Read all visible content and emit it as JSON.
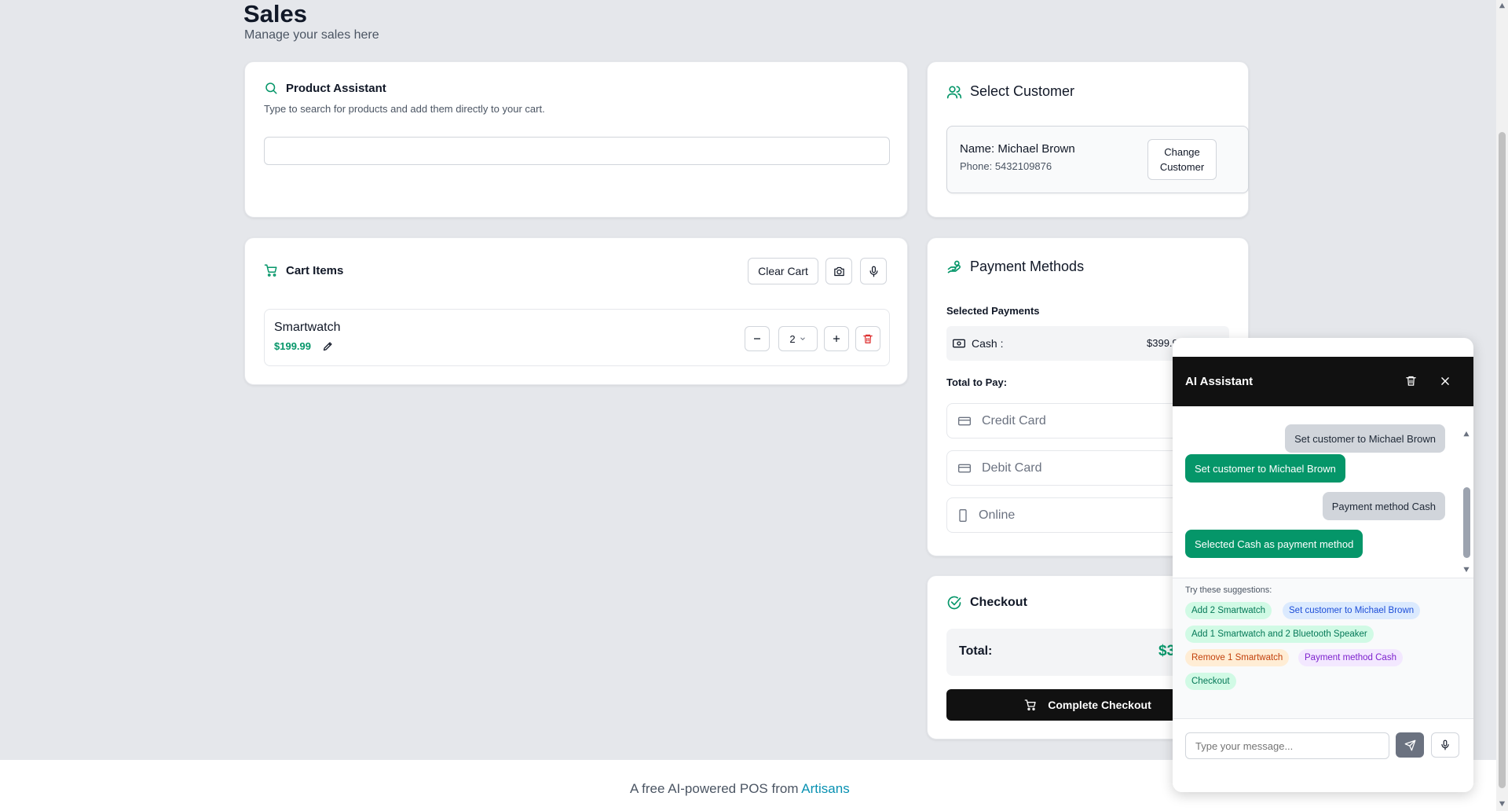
{
  "page": {
    "title": "Sales",
    "subtitle": "Manage your sales here"
  },
  "product_assistant": {
    "title": "Product Assistant",
    "description": "Type to search for products and add them directly to your cart.",
    "search_placeholder": "",
    "search_icon": "search-icon"
  },
  "cart": {
    "title": "Cart Items",
    "clear_label": "Clear Cart",
    "items": [
      {
        "name": "Smartwatch",
        "price": "$199.99",
        "quantity": "2"
      }
    ]
  },
  "customer": {
    "title": "Select Customer",
    "name": "Name: Michael Brown",
    "phone": "Phone: 5432109876",
    "change_label_1": "Change",
    "change_label_2": "Customer"
  },
  "payment": {
    "title": "Payment Methods",
    "selected_label": "Selected Payments",
    "selected": {
      "method": "Cash :",
      "amount": "$399.9"
    },
    "total_label": "Total to Pay:",
    "methods": [
      "Credit Card",
      "Debit Card",
      "Online"
    ]
  },
  "checkout": {
    "title": "Checkout",
    "total_label": "Total:",
    "total_value": "$3",
    "button_label": "Complete Checkout"
  },
  "footer": {
    "text": "A free AI-powered POS from ",
    "link": "Artisans"
  },
  "ai_assistant": {
    "title": "AI Assistant",
    "messages": [
      {
        "role": "user",
        "text": "Set customer to Michael Brown"
      },
      {
        "role": "bot",
        "text": "Set customer to Michael Brown"
      },
      {
        "role": "user",
        "text": "Payment method Cash"
      },
      {
        "role": "bot",
        "text": "Selected Cash as payment method"
      }
    ],
    "suggestions_label": "Try these suggestions:",
    "suggestions": [
      "Add 2 Smartwatch",
      "Set customer to Michael Brown",
      "Add 1 Smartwatch and 2 Bluetooth Speaker",
      "Remove 1 Smartwatch",
      "Payment method Cash",
      "Checkout"
    ],
    "input_placeholder": "Type your message..."
  },
  "colors": {
    "accent": "#059669",
    "dark": "#111111",
    "danger": "#dc2626",
    "link": "#0891b2"
  }
}
